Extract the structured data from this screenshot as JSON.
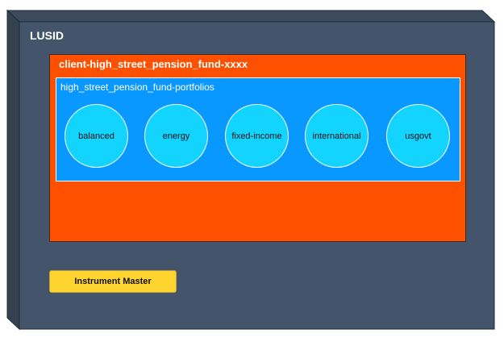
{
  "node": {
    "title": "LUSID"
  },
  "tenant": {
    "title": "client-high_street_pension_fund-xxxx"
  },
  "scope": {
    "title": "high_street_pension_fund-portfolios"
  },
  "portfolios": [
    {
      "label": "balanced"
    },
    {
      "label": "energy"
    },
    {
      "label": "fixed-income"
    },
    {
      "label": "international"
    },
    {
      "label": "usgovt"
    }
  ],
  "instrument_master": {
    "label": "Instrument Master"
  },
  "colors": {
    "node_front": "#44546a",
    "node_side": "#3b4a5d",
    "tenant": "#ff5000",
    "scope": "#0898ff",
    "portfolio": "#12d4ff",
    "instrument_master": "#ffd42e"
  }
}
